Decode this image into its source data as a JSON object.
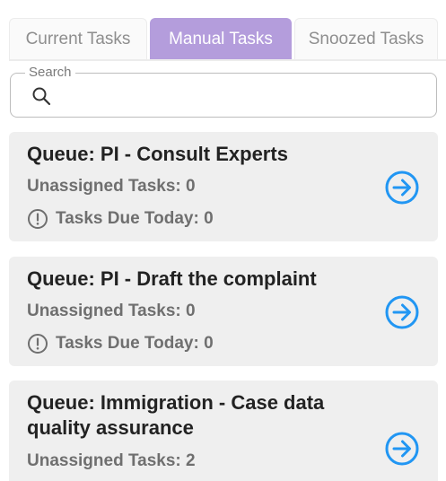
{
  "tabs": [
    {
      "label": "Current Tasks",
      "active": false
    },
    {
      "label": "Manual Tasks",
      "active": true
    },
    {
      "label": "Snoozed Tasks",
      "active": false
    }
  ],
  "search": {
    "label": "Search",
    "value": "",
    "icon": "search-icon"
  },
  "queues": [
    {
      "title": "Queue: PI - Consult Experts",
      "unassigned": "Unassigned Tasks: 0",
      "due": "Tasks Due Today: 0"
    },
    {
      "title": "Queue: PI - Draft the complaint",
      "unassigned": "Unassigned Tasks: 0",
      "due": "Tasks Due Today: 0"
    },
    {
      "title": "Queue: Immigration - Case data quality assurance",
      "unassigned": "Unassigned Tasks: 2"
    }
  ],
  "colors": {
    "active_tab": "#b49ddc",
    "card_background": "#efefef",
    "arrow_icon": "#2196f3"
  }
}
